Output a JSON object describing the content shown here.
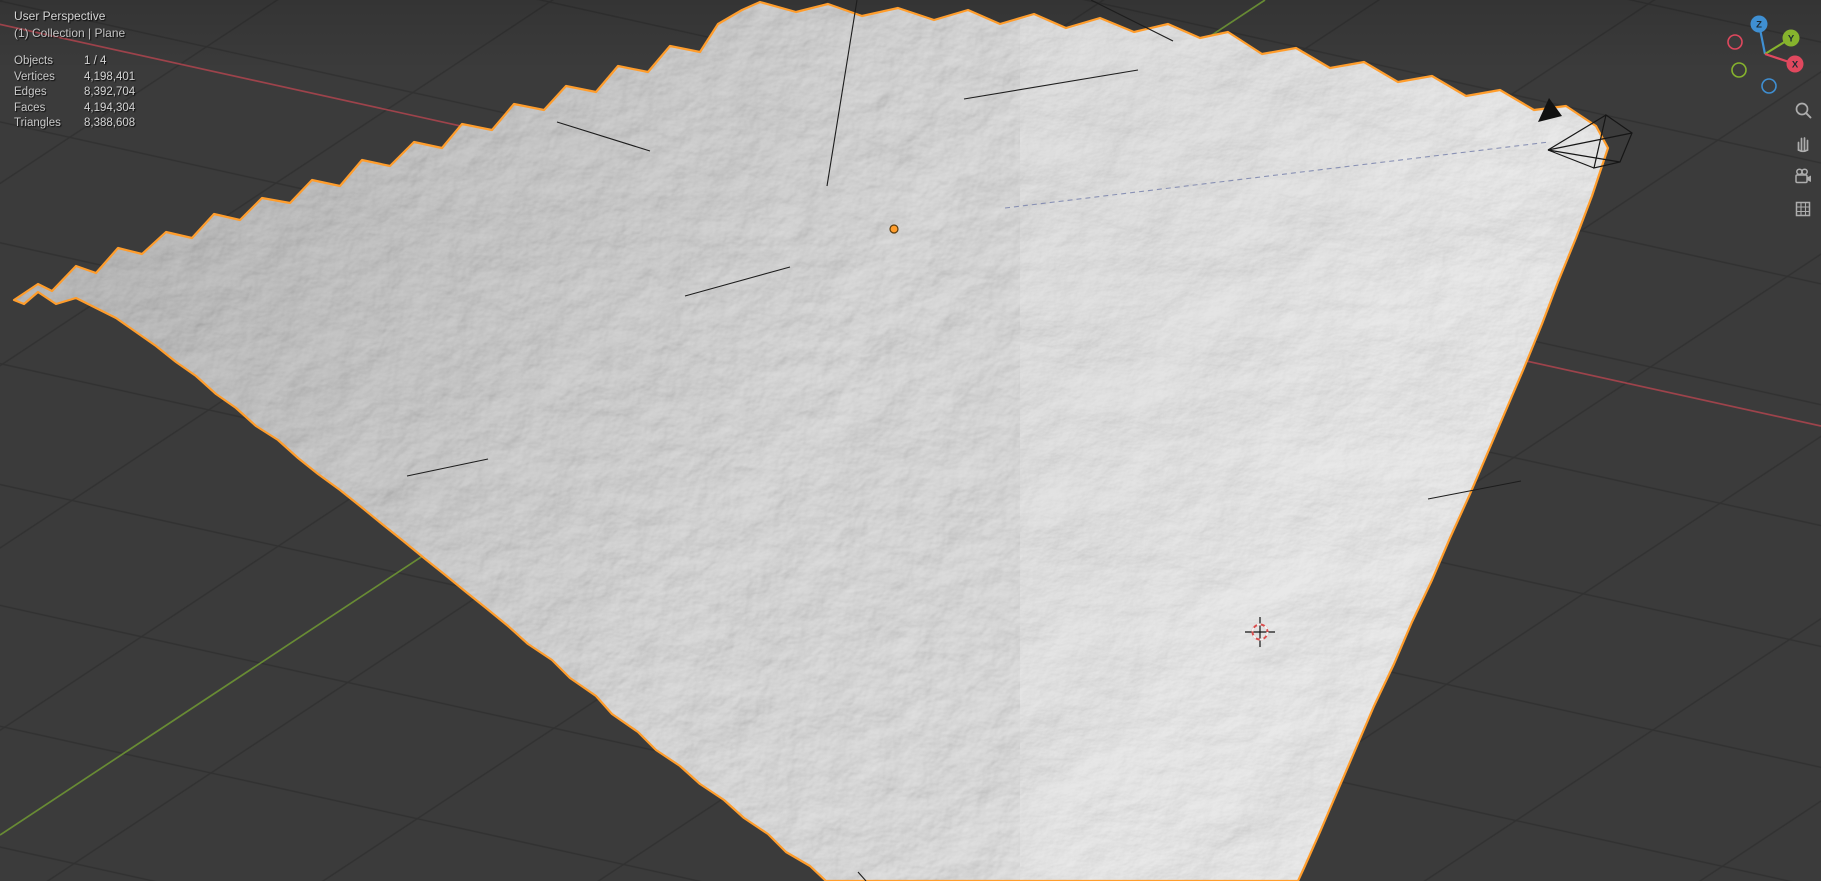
{
  "viewport": {
    "perspective_label": "User Perspective",
    "context_label": "(1) Collection | Plane"
  },
  "stats": {
    "rows": [
      {
        "label": "Objects",
        "value": "1 / 4"
      },
      {
        "label": "Vertices",
        "value": "4,198,401"
      },
      {
        "label": "Edges",
        "value": "8,392,704"
      },
      {
        "label": "Faces",
        "value": "4,194,304"
      },
      {
        "label": "Triangles",
        "value": "8,388,608"
      }
    ]
  },
  "gizmo": {
    "z_label": "Z",
    "y_label": "Y",
    "x_label": "X"
  },
  "toolbar": {
    "icons": [
      "zoom-icon",
      "move-view-icon",
      "camera-view-icon",
      "toggle-projection-icon"
    ]
  },
  "scene_objects": {
    "selected_object": "Plane",
    "markers": [
      "object-origin",
      "3d-cursor",
      "camera-object"
    ]
  },
  "colors": {
    "background": "#3b3b3b",
    "grid_line": "#313131",
    "selection_outline": "#ff9d2c",
    "axis_x": "#a8444d",
    "axis_y": "#6d9434",
    "gizmo_x": "#e0485e",
    "gizmo_y": "#86b32d",
    "gizmo_z": "#3f8fd2",
    "mesh_base": "#b5b5b5"
  }
}
